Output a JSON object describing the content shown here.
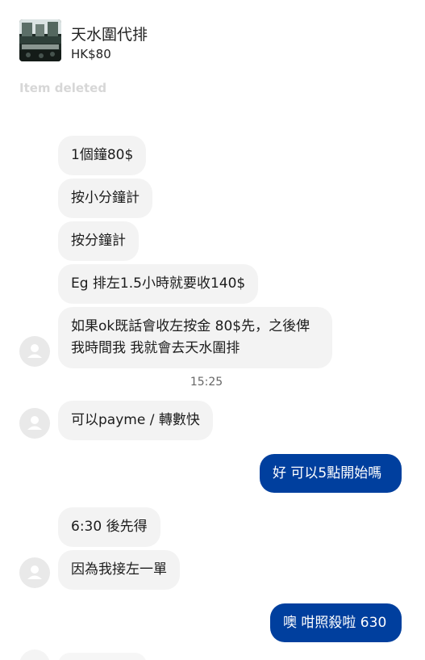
{
  "listing": {
    "title": "天水圍代排",
    "price": "HK$80"
  },
  "status_note": "Item deleted",
  "messages": {
    "m1": "1個鐘80$",
    "m2": "按小分鐘計",
    "m3": "按分鐘計",
    "m4": "Eg 排左1.5小時就要收140$",
    "m5": "如果ok既話會收左按金 80$先，之後俾我時間我 我就會去天水圍排",
    "m6": "可以payme / 轉數快",
    "m7": "好 可以5點開始嗎",
    "m8": "6:30 後先得",
    "m9": "因為我接左一單",
    "m10": "噢 咁照殺啦 630"
  },
  "timestamp": "15:25",
  "colors": {
    "incoming_bubble": "#f3f3f3",
    "outgoing_bubble": "#003f9e",
    "muted_text": "#d7d7d7"
  },
  "icons": {
    "avatar": "user-avatar-icon"
  }
}
